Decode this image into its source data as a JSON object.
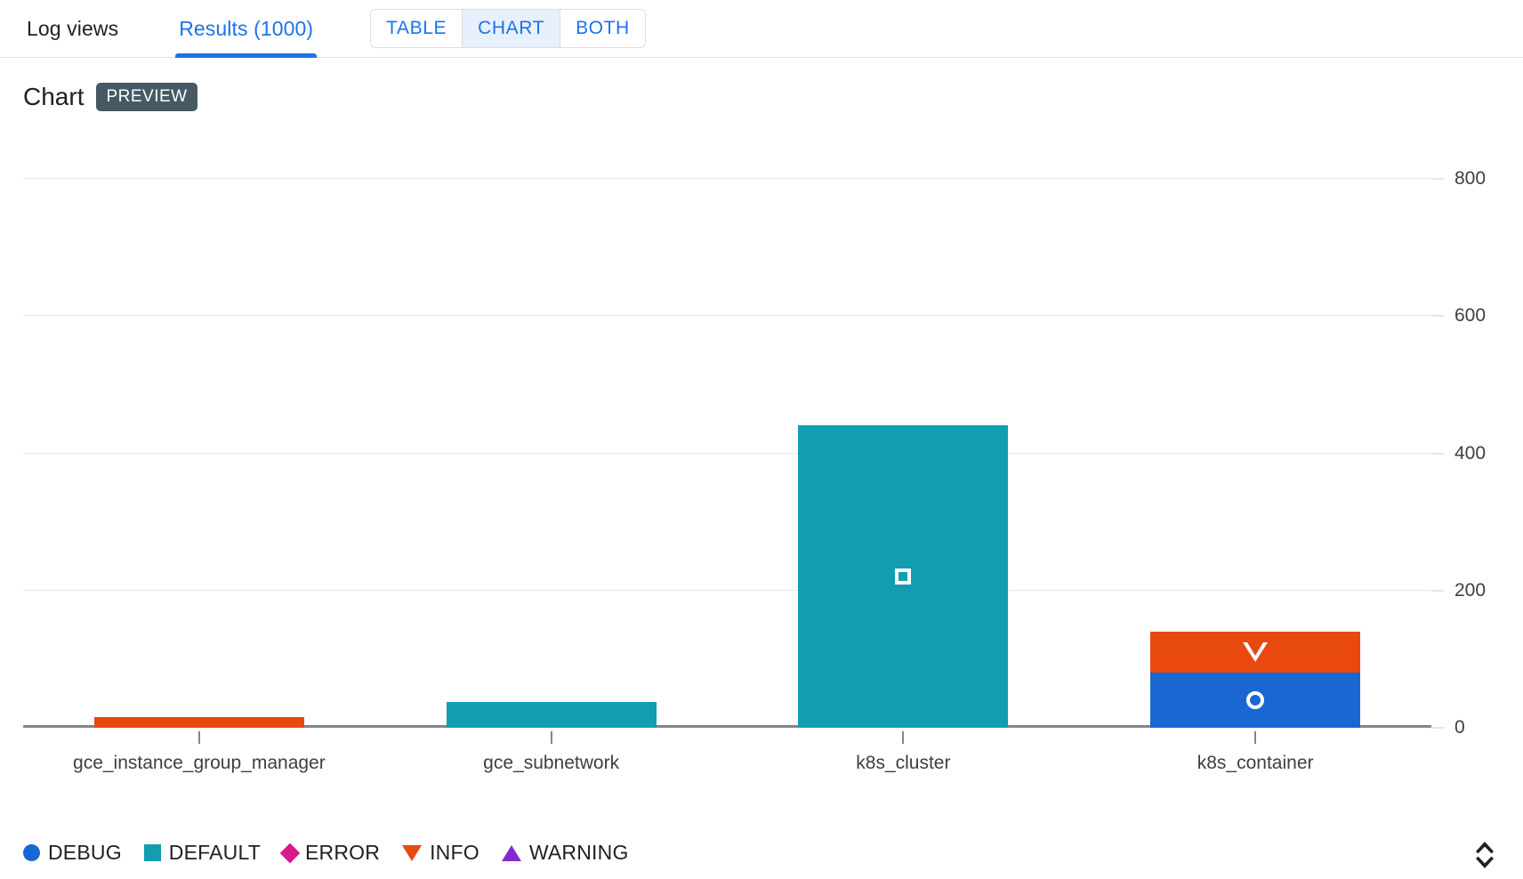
{
  "topbar": {
    "tabs": [
      {
        "label": "Log views",
        "active": false
      },
      {
        "label": "Results (1000)",
        "active": true
      }
    ],
    "view_toggle": {
      "options": [
        "TABLE",
        "CHART",
        "BOTH"
      ],
      "selected": "CHART"
    }
  },
  "chart_panel": {
    "title": "Chart",
    "badge": "PREVIEW",
    "expand_icon": "expand-collapse-icon"
  },
  "chart_data": {
    "type": "bar",
    "stacked": true,
    "title": "Chart",
    "xlabel": "",
    "ylabel": "",
    "ylim": [
      0,
      800
    ],
    "yticks": [
      0,
      200,
      400,
      600,
      800
    ],
    "ytick_labels": [
      "0",
      "200",
      "400",
      "600",
      "800"
    ],
    "grid": true,
    "legend_position": "bottom-left",
    "categories": [
      "gce_instance_group_manager",
      "gce_subnetwork",
      "k8s_cluster",
      "k8s_container"
    ],
    "series": [
      {
        "name": "DEBUG",
        "color": "#1a67d2",
        "marker": "circle",
        "values": [
          0,
          0,
          0,
          81
        ]
      },
      {
        "name": "DEFAULT",
        "color": "#129db0",
        "marker": "square",
        "values": [
          0,
          37,
          441,
          0
        ]
      },
      {
        "name": "ERROR",
        "color": "#d81b8c",
        "marker": "diamond",
        "values": [
          0,
          0,
          0,
          0
        ]
      },
      {
        "name": "INFO",
        "color": "#e8490f",
        "marker": "triangle-down",
        "values": [
          16,
          0,
          0,
          59
        ]
      },
      {
        "name": "WARNING",
        "color": "#7d2cd0",
        "marker": "triangle-up",
        "values": [
          0,
          0,
          0,
          0
        ]
      }
    ]
  },
  "colors": {
    "accent": "#1a73e8",
    "selected_bg": "#e8f0fe",
    "badge_bg": "#455a64",
    "axis": "#80868b",
    "grid": "#e8e8e8"
  }
}
